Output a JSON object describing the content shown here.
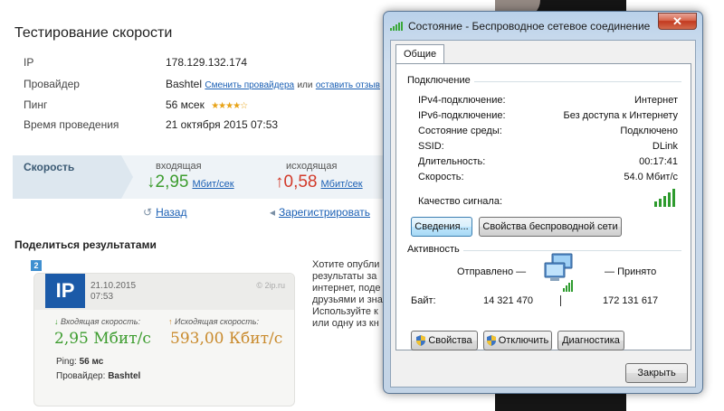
{
  "page": {
    "title": "Тестирование скорости",
    "info": [
      {
        "label": "IP",
        "value": "178.129.132.174"
      },
      {
        "label": "Провайдер",
        "value": "Bashtel",
        "link1": "Сменить провайдера",
        "or": "или",
        "link2": "оставить отзыв"
      },
      {
        "label": "Пинг",
        "value": "56 мсек",
        "stars": "★★★★☆",
        "rating": 4
      },
      {
        "label": "Время проведения",
        "value": "21 октября 2015 07:53"
      }
    ],
    "speed": {
      "label": "Скорость",
      "down_title": "входящая",
      "down_arrow": "↓",
      "down_value": "2,95",
      "down_unit": "Мбит/сек",
      "up_title": "исходящая",
      "up_arrow": "↑",
      "up_value": "0,58",
      "up_unit": "Мбит/сек"
    },
    "back_link": "Назад",
    "back_icon": "↺",
    "register_link": "Зарегистрировать",
    "register_icon": "◂",
    "share_title": "Поделиться результатами",
    "share_text": [
      "Хотите опубли",
      "результаты за",
      "интернет, поде",
      "друзьями и зна",
      "Используйте к",
      "или одну из кн"
    ],
    "card": {
      "number": "2",
      "logo": "IP",
      "date": "21.10.2015",
      "time": "07:53",
      "site": "© 2ip.ru",
      "down_label": "Входящая скорость:",
      "down_arrow": "↓",
      "up_label": "Исходящая скорость:",
      "up_arrow": "↑",
      "down_value": "2,95 Мбит/с",
      "up_value": "593,00 Кбит/с",
      "ping_label": "Ping:",
      "ping_value": "56 мс",
      "provider_label": "Провайдер:",
      "provider_value": "Bashtel"
    }
  },
  "dialog": {
    "title": "Состояние - Беспроводное сетевое соединение",
    "close_glyph": "✕",
    "tab": "Общие",
    "connection_group": "Подключение",
    "rows": [
      {
        "key": "IPv4-подключение:",
        "value": "Интернет"
      },
      {
        "key": "IPv6-подключение:",
        "value": "Без доступа к Интернету"
      },
      {
        "key": "Состояние среды:",
        "value": "Подключено"
      },
      {
        "key": "SSID:",
        "value": "DLink"
      },
      {
        "key": "Длительность:",
        "value": "00:17:41"
      },
      {
        "key": "Скорость:",
        "value": "54.0 Мбит/с"
      }
    ],
    "signal_label": "Качество сигнала:",
    "signal_bars": 5,
    "details_button": "Сведения...",
    "wireless_props_button": "Свойства беспроводной сети",
    "activity_group": "Активность",
    "sent_label": "Отправлено",
    "received_label": "Принято",
    "bytes_label": "Байт:",
    "bytes_sent": "14 321 470",
    "bytes_received": "172 131 617",
    "properties_button": "Свойства",
    "disable_button": "Отключить",
    "diagnostics_button": "Диагностика",
    "close_button": "Закрыть"
  }
}
